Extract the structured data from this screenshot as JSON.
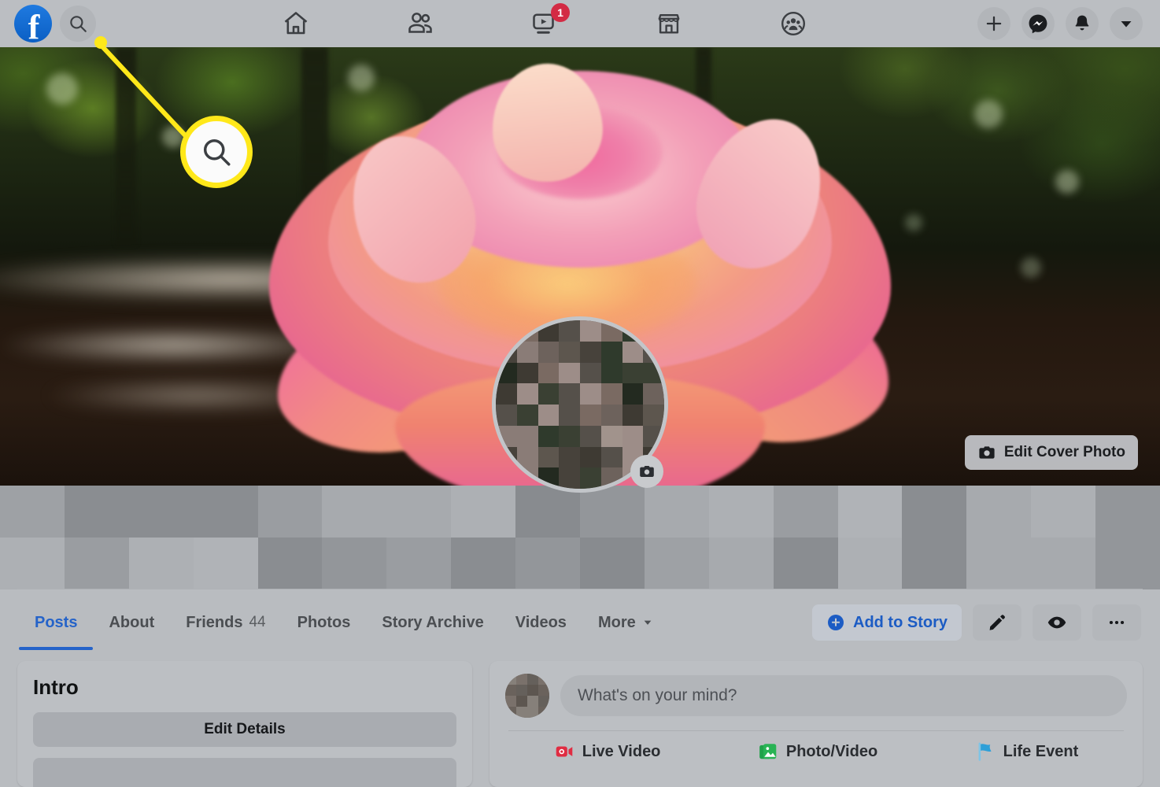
{
  "topnav": {
    "logo_name": "facebook-logo",
    "search_icon_label": "search-icon",
    "items": [
      {
        "name": "home",
        "icon": "home-icon",
        "badge": ""
      },
      {
        "name": "friends",
        "icon": "friends-icon",
        "badge": ""
      },
      {
        "name": "watch",
        "icon": "video-icon",
        "badge": "1"
      },
      {
        "name": "marketplace",
        "icon": "marketplace-icon",
        "badge": ""
      },
      {
        "name": "groups",
        "icon": "groups-icon",
        "badge": ""
      }
    ],
    "right_buttons": [
      {
        "name": "create",
        "icon": "plus-icon"
      },
      {
        "name": "messenger",
        "icon": "messenger-icon"
      },
      {
        "name": "notifications",
        "icon": "bell-icon"
      },
      {
        "name": "account",
        "icon": "chevron-down-icon"
      }
    ]
  },
  "cover": {
    "edit_label": "Edit Cover Photo",
    "camera_icon": "camera-icon"
  },
  "profile": {
    "name_redacted": true,
    "add_bio_label": "Add Bio",
    "photo_camera_icon": "camera-icon"
  },
  "tabs": [
    {
      "label": "Posts",
      "count": "",
      "active": true
    },
    {
      "label": "About",
      "count": "",
      "active": false
    },
    {
      "label": "Friends",
      "count": "44",
      "active": false
    },
    {
      "label": "Photos",
      "count": "",
      "active": false
    },
    {
      "label": "Story Archive",
      "count": "",
      "active": false
    },
    {
      "label": "Videos",
      "count": "",
      "active": false
    },
    {
      "label": "More",
      "count": "",
      "active": false
    }
  ],
  "actions": {
    "add_to_story": "Add to Story",
    "edit_profile_icon": "pencil-icon",
    "view_as_icon": "eye-icon",
    "more_icon": "ellipsis-icon"
  },
  "intro": {
    "title": "Intro",
    "edit_details": "Edit Details"
  },
  "composer": {
    "placeholder": "What's on your mind?",
    "actions": [
      {
        "label": "Live Video",
        "icon": "live-video-icon",
        "color": "#e02c42"
      },
      {
        "label": "Photo/Video",
        "icon": "photo-video-icon",
        "color": "#20a24a"
      },
      {
        "label": "Life Event",
        "icon": "life-event-icon",
        "color": "#2e9fd8"
      }
    ]
  },
  "annotation": {
    "target": "search-icon",
    "highlight_color": "#ffe81a"
  },
  "colors": {
    "brand_blue": "#1877f2",
    "link_blue": "#1a56c4",
    "badge_red": "#d32b44",
    "highlight_yellow": "#ffe81a",
    "page_bg": "#b9bcc0"
  }
}
